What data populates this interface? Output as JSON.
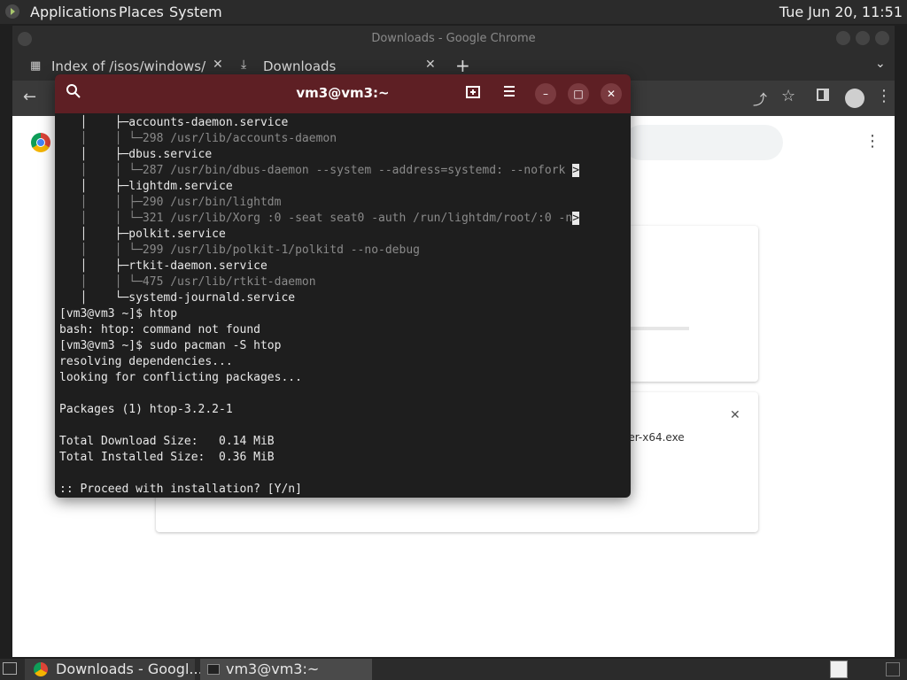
{
  "topbar": {
    "applications": "Applications",
    "places": "Places",
    "system": "System",
    "clock": "Tue Jun 20, 11:51"
  },
  "chrome": {
    "window_title": "Downloads - Google Chrome",
    "tabs": [
      {
        "label": "Index of /isos/windows/"
      },
      {
        "label": "Downloads"
      }
    ],
    "download_filename_fragment": "ler-x64.exe"
  },
  "terminal": {
    "title": "vm3@vm3:~",
    "lines": [
      {
        "text": "   │    ├─accounts-daemon.service"
      },
      {
        "text": "   │    │ └─298 /usr/lib/accounts-daemon",
        "dim": true
      },
      {
        "text": "   │    ├─dbus.service"
      },
      {
        "text": "   │    │ └─287 /usr/bin/dbus-daemon --system --address=systemd: --nofork ",
        "dim": true,
        "trunc": ">"
      },
      {
        "text": "   │    ├─lightdm.service"
      },
      {
        "text": "   │    │ ├─290 /usr/bin/lightdm",
        "dim": true
      },
      {
        "text": "   │    │ └─321 /usr/lib/Xorg :0 -seat seat0 -auth /run/lightdm/root/:0 -n",
        "dim": true,
        "trunc": ">"
      },
      {
        "text": "   │    ├─polkit.service"
      },
      {
        "text": "   │    │ └─299 /usr/lib/polkit-1/polkitd --no-debug",
        "dim": true
      },
      {
        "text": "   │    ├─rtkit-daemon.service"
      },
      {
        "text": "   │    │ └─475 /usr/lib/rtkit-daemon",
        "dim": true
      },
      {
        "text": "   │    └─systemd-journald.service"
      },
      {
        "text": "[vm3@vm3 ~]$ htop"
      },
      {
        "text": "bash: htop: command not found"
      },
      {
        "text": "[vm3@vm3 ~]$ sudo pacman -S htop"
      },
      {
        "text": "resolving dependencies..."
      },
      {
        "text": "looking for conflicting packages..."
      },
      {
        "text": ""
      },
      {
        "text": "Packages (1) htop-3.2.2-1"
      },
      {
        "text": ""
      },
      {
        "text": "Total Download Size:   0.14 MiB"
      },
      {
        "text": "Total Installed Size:  0.36 MiB"
      },
      {
        "text": ""
      },
      {
        "text": ":: Proceed with installation? [Y/n]"
      }
    ]
  },
  "taskbar": {
    "items": [
      {
        "label": "Downloads - Googl..."
      },
      {
        "label": "vm3@vm3:~"
      }
    ]
  },
  "icons": {
    "terminal_search": "search-icon",
    "terminal_new_tab": "new-tab-icon",
    "terminal_menu": "hamburger-menu-icon",
    "minimize": "minimize-icon",
    "maximize": "maximize-icon",
    "close": "close-icon"
  },
  "colors": {
    "terminal_header": "#5e1f24",
    "terminal_bg": "#1e1e1e",
    "panel_bg": "#2b2b2b"
  }
}
